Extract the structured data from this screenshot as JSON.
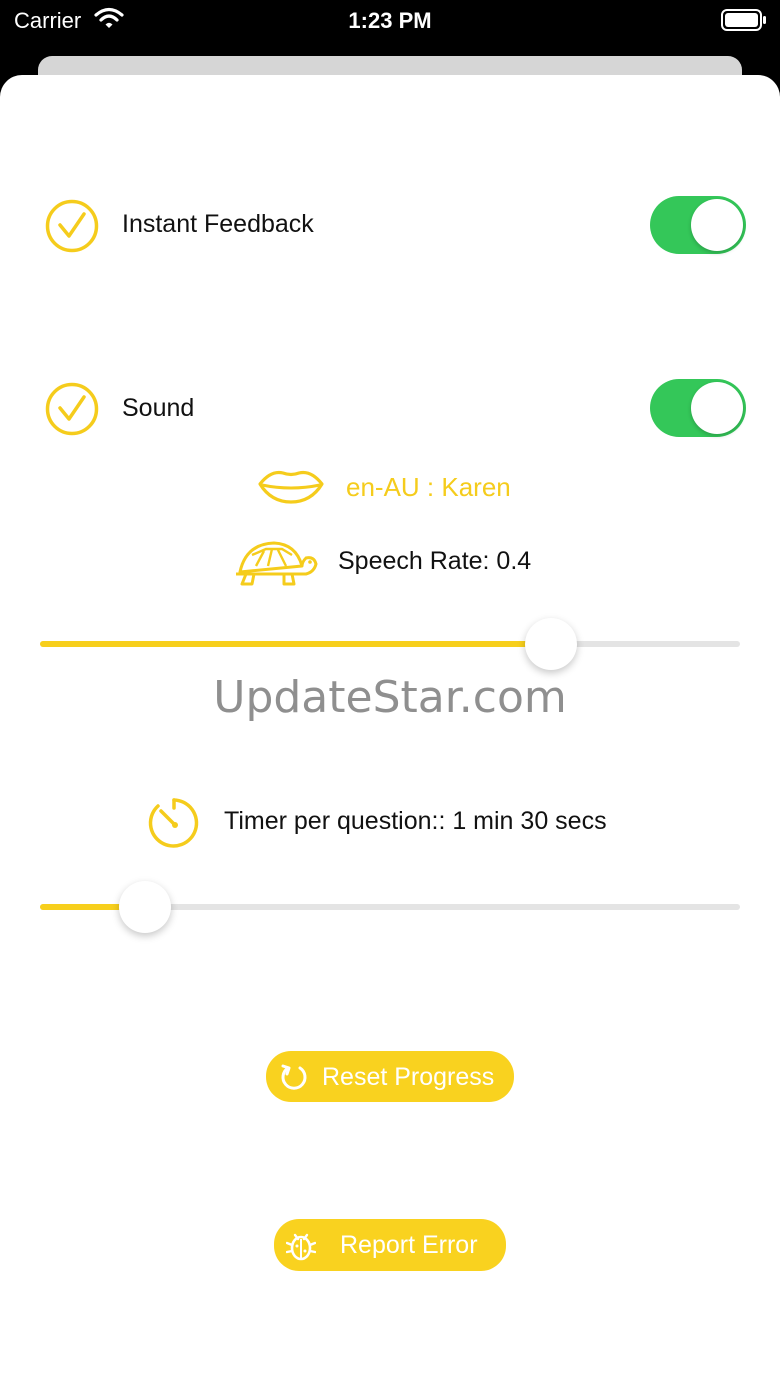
{
  "status_bar": {
    "carrier": "Carrier",
    "time": "1:23 PM"
  },
  "settings": {
    "instant_feedback": {
      "label": "Instant Feedback",
      "enabled": true
    },
    "sound": {
      "label": "Sound",
      "enabled": true
    },
    "voice": "en-AU : Karen",
    "speech_rate": {
      "label": "Speech Rate: 0.4",
      "value": 0.4,
      "fraction": 0.73
    },
    "watermark": "UpdateStar.com",
    "timer": {
      "label": "Timer per question:: 1 min 30 secs",
      "fraction": 0.15
    }
  },
  "buttons": {
    "reset": "Reset Progress",
    "report": "Report Error"
  },
  "colors": {
    "accent": "#f9d21f",
    "toggle_on": "#34c759"
  },
  "icons": [
    "checkmark-circle-icon",
    "lips-icon",
    "turtle-icon",
    "timer-icon",
    "reset-icon",
    "bug-icon",
    "wifi-icon",
    "battery-icon"
  ]
}
